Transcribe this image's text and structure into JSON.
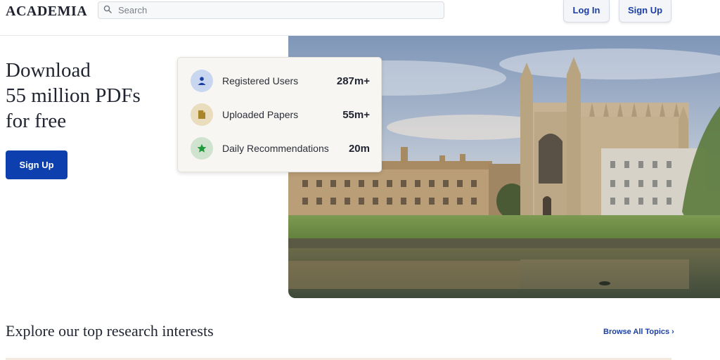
{
  "header": {
    "logo": "ACADEMIA",
    "search_placeholder": "Search",
    "login_label": "Log In",
    "signup_label": "Sign Up"
  },
  "hero": {
    "title": "Download\n55 million PDFs\nfor free",
    "signup_label": "Sign Up"
  },
  "stats": [
    {
      "label": "Registered Users",
      "value": "287m+",
      "icon": "user-icon",
      "icon_bg": "#c9d6f0",
      "icon_color": "#1b3fa3"
    },
    {
      "label": "Uploaded Papers",
      "value": "55m+",
      "icon": "document-icon",
      "icon_bg": "#e9ddbe",
      "icon_color": "#a8842a"
    },
    {
      "label": "Daily Recommendations",
      "value": "20m",
      "icon": "star-icon",
      "icon_bg": "#cfe3cf",
      "icon_color": "#1f9a3a"
    }
  ],
  "explore": {
    "title": "Explore our top research interests",
    "browse_label": "Browse All Topics ›"
  },
  "colors": {
    "brand_blue": "#0e3fae",
    "link_blue": "#1b3fa3"
  }
}
